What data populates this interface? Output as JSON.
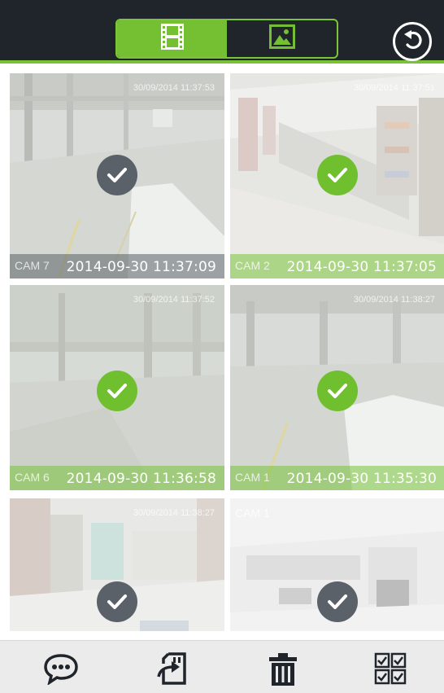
{
  "header": {
    "tabs": [
      {
        "id": "video",
        "icon": "film-icon",
        "active": true
      },
      {
        "id": "photo",
        "icon": "image-icon",
        "active": false
      }
    ],
    "back_icon": "back-arrow-icon"
  },
  "thumbnails": [
    {
      "cam": "CAM 7",
      "timestamp": "2014-09-30 11:37:09",
      "osd": "30/09/2014 11:37:53",
      "selected": false,
      "scene": "lot"
    },
    {
      "cam": "CAM 2",
      "timestamp": "2014-09-30 11:37:05",
      "osd": "30/09/2014 11:37:51",
      "selected": true,
      "scene": "shop"
    },
    {
      "cam": "CAM 6",
      "timestamp": "2014-09-30 11:36:58",
      "osd": "30/09/2014 11:37:52",
      "selected": true,
      "scene": "lot2"
    },
    {
      "cam": "CAM 1",
      "timestamp": "2014-09-30 11:35:30",
      "osd": "30/09/2014 11:38:27",
      "selected": true,
      "scene": "lot3"
    },
    {
      "cam": "",
      "timestamp": "",
      "osd": "30/09/2014 11:38:27",
      "selected": false,
      "scene": "store"
    },
    {
      "cam": "CAM 1",
      "timestamp": "",
      "osd": "",
      "selected": false,
      "scene": "office"
    }
  ],
  "toolbar": {
    "items": [
      "chat-icon",
      "export-icon",
      "trash-icon",
      "select-all-icon"
    ]
  },
  "colors": {
    "accent": "#74c032",
    "topbar": "#1f252b",
    "check_unselected": "#5a6168",
    "check_selected": "#6fbf2e"
  }
}
